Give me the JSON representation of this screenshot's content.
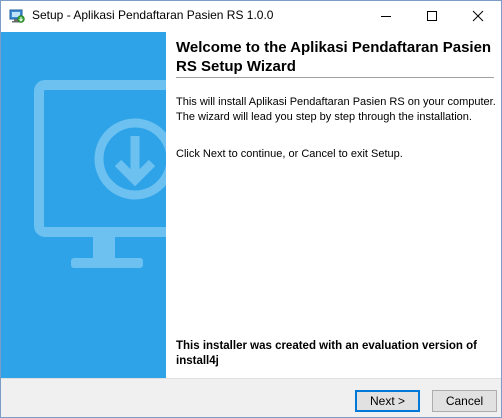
{
  "window": {
    "title": "Setup - Aplikasi Pendaftaran Pasien RS 1.0.0",
    "icon": "installer-icon",
    "controls": {
      "minimize": "minimize-icon",
      "maximize": "maximize-icon",
      "close": "close-icon"
    }
  },
  "sidebar": {
    "background_color": "#2ea3e8",
    "illustration": "monitor-download-icon"
  },
  "main": {
    "heading": "Welcome to the Aplikasi Pendaftaran Pasien RS Setup Wizard",
    "paragraph1": "This will install Aplikasi Pendaftaran Pasien RS on your computer. The wizard will lead you step by step through the installation.",
    "paragraph2": "Click Next to continue, or Cancel to exit Setup.",
    "footer_note": "This installer was created with an evaluation version of install4j"
  },
  "buttons": {
    "next_label": "Next >",
    "cancel_label": "Cancel"
  }
}
